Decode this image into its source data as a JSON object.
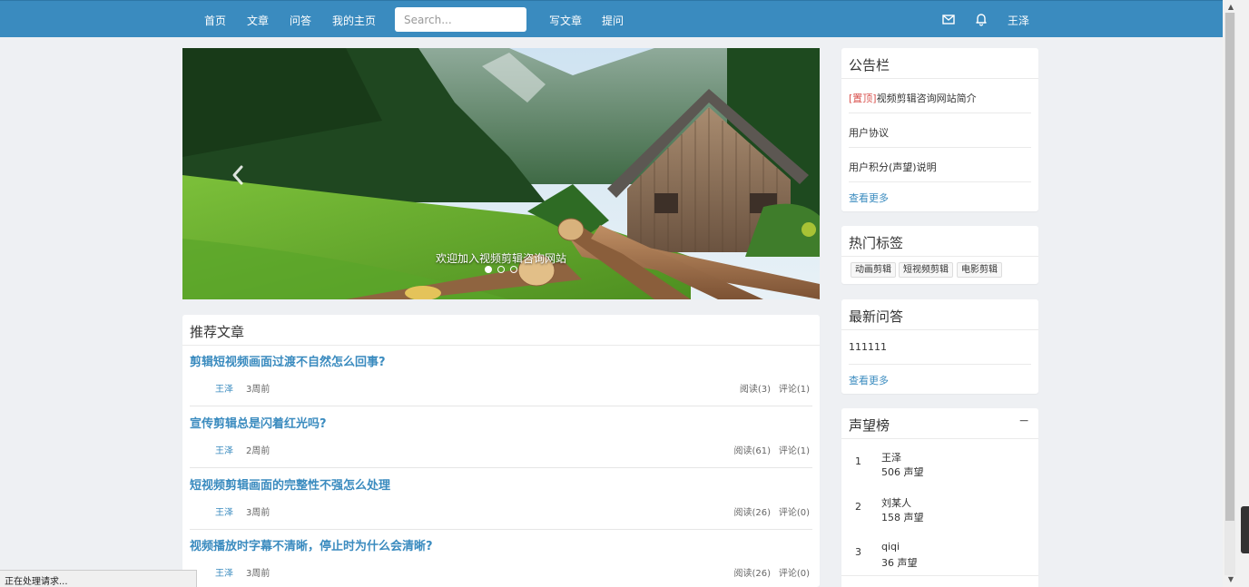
{
  "nav": {
    "home": "首页",
    "articles": "文章",
    "qa": "问答",
    "my_home": "我的主页",
    "search_placeholder": "Search...",
    "write_article": "写文章",
    "ask_question": "提问",
    "mail_icon": "envelope-icon",
    "bell_icon": "bell-icon",
    "username": "王泽"
  },
  "carousel": {
    "caption": "欢迎加入视频剪辑咨询网站",
    "slides": 3,
    "active_slide": 1
  },
  "recommended": {
    "title": "推荐文章",
    "items": [
      {
        "title": "剪辑短视频画面过渡不自然怎么回事?",
        "author": "王泽",
        "time": "3周前",
        "reads": "阅读(3)",
        "comments": "评论(1)"
      },
      {
        "title": "宣传剪辑总是闪着红光吗?",
        "author": "王泽",
        "time": "2周前",
        "reads": "阅读(61)",
        "comments": "评论(1)"
      },
      {
        "title": "短视频剪辑画面的完整性不强怎么处理",
        "author": "王泽",
        "time": "3周前",
        "reads": "阅读(26)",
        "comments": "评论(0)"
      },
      {
        "title": "视频播放时字幕不清晰，停止时为什么会清晰?",
        "author": "王泽",
        "time": "3周前",
        "reads": "阅读(26)",
        "comments": "评论(0)"
      }
    ]
  },
  "announcements": {
    "title": "公告栏",
    "pinned_label": "[置顶]",
    "items": [
      "视频剪辑咨询网站简介",
      "用户协议",
      "用户积分(声望)说明"
    ],
    "more": "查看更多"
  },
  "hot_tags": {
    "title": "热门标签",
    "tags": [
      "动画剪辑",
      "短视频剪辑",
      "电影剪辑"
    ]
  },
  "latest_qa": {
    "title": "最新问答",
    "items": [
      "111111"
    ],
    "more": "查看更多"
  },
  "reputation": {
    "title": "声望榜",
    "collapse_symbol": "−",
    "items": [
      {
        "rank": "1",
        "name": "王泽",
        "score": "506 声望"
      },
      {
        "rank": "2",
        "name": "刘某人",
        "score": "158 声望"
      },
      {
        "rank": "3",
        "name": "qiqi",
        "score": "36 声望"
      }
    ]
  },
  "status_bar": {
    "text": "正在处理请求..."
  },
  "colors": {
    "nav": "#3a8bbf",
    "link": "#3a8bbf",
    "pinned": "#d9534f",
    "page_bg": "#eef0f3"
  }
}
